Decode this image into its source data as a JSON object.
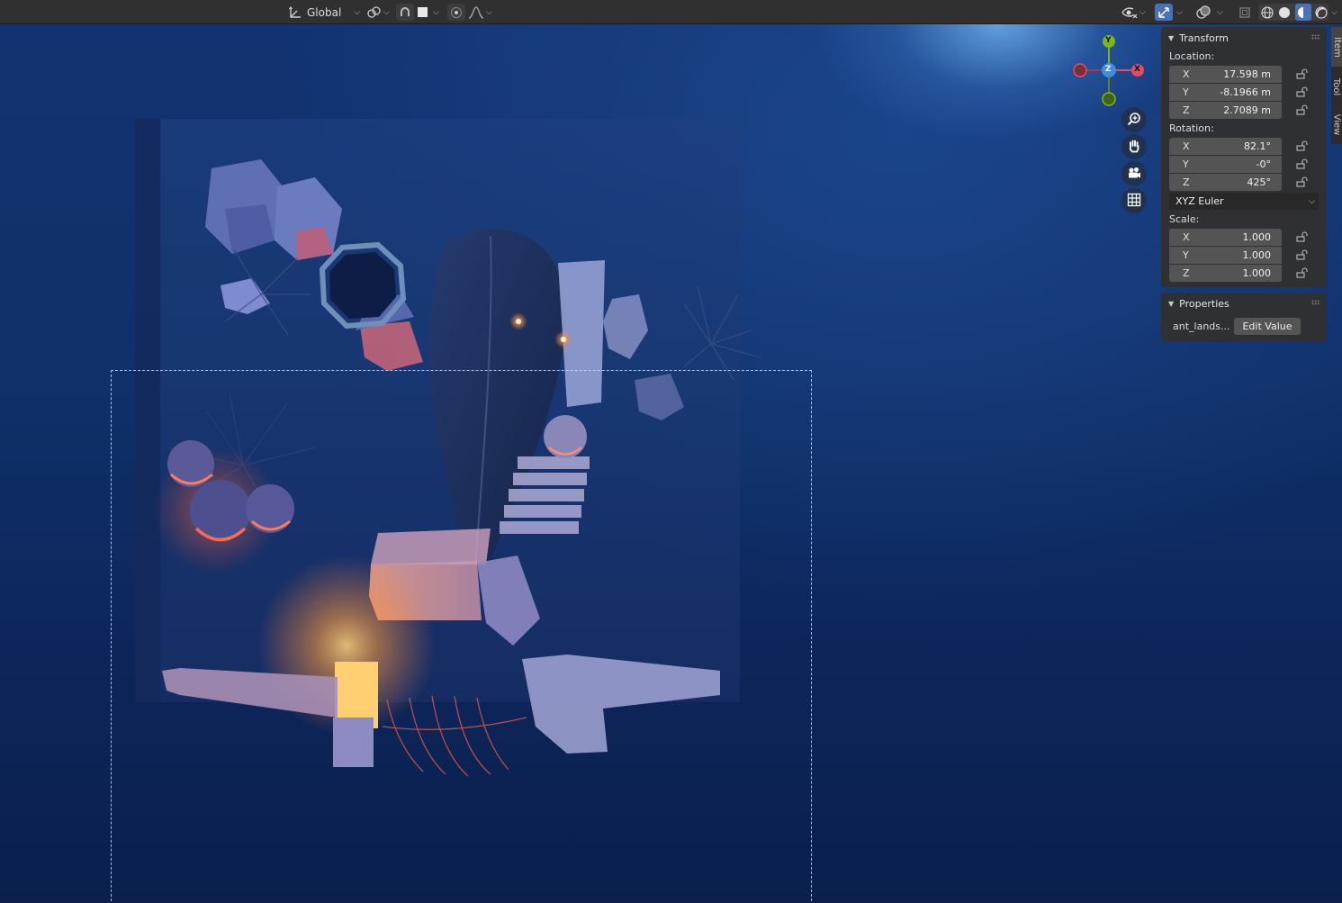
{
  "header": {
    "transform_orientation": "Global",
    "icons": [
      "transform-orientation-icon",
      "pivot-point-icon",
      "snap-icon",
      "snap-increment-icon",
      "proportional-editing-icon",
      "falloff-curve-icon",
      "visibility-eye-icon",
      "gizmo-icon",
      "overlays-icon",
      "xray-icon",
      "wireframe-shading-icon",
      "solid-shading-icon",
      "material-preview-icon",
      "rendered-shading-icon"
    ]
  },
  "gizmo": {
    "x": "X",
    "y": "Y",
    "z": "Z"
  },
  "npanel": {
    "transform": {
      "title": "Transform",
      "location_label": "Location:",
      "location": [
        {
          "axis": "X",
          "value": "17.598 m"
        },
        {
          "axis": "Y",
          "value": "-8.1966 m"
        },
        {
          "axis": "Z",
          "value": "2.7089 m"
        }
      ],
      "rotation_label": "Rotation:",
      "rotation": [
        {
          "axis": "X",
          "value": "82.1°"
        },
        {
          "axis": "Y",
          "value": "-0°"
        },
        {
          "axis": "Z",
          "value": "425°"
        }
      ],
      "rotation_mode": "XYZ Euler",
      "scale_label": "Scale:",
      "scale": [
        {
          "axis": "X",
          "value": "1.000"
        },
        {
          "axis": "Y",
          "value": "1.000"
        },
        {
          "axis": "Z",
          "value": "1.000"
        }
      ]
    },
    "properties": {
      "title": "Properties",
      "prop_name": "ant_lands...",
      "edit_label": "Edit Value"
    }
  },
  "sidetabs": [
    "Item",
    "Tool",
    "View"
  ],
  "colors": {
    "accent": "#4772b3",
    "axis_x": "#e44c63",
    "axis_y": "#7bb61a",
    "axis_z": "#3d8ee0",
    "viewport_bg": "#10306a"
  }
}
